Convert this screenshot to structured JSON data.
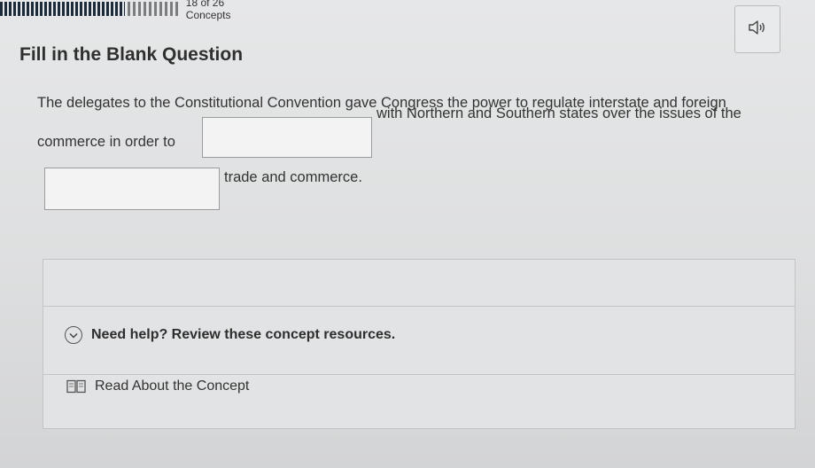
{
  "progress": {
    "text": "18 of 26 Concepts",
    "fraction": 0.69
  },
  "question": {
    "title": "Fill in the Blank Question",
    "line1": "The delegates to the Constitutional Convention gave Congress the power to regulate interstate and foreign",
    "line2_before": "commerce in order to",
    "line2_after": "with Northern and Southern states over the issues of the",
    "line3_after": "trade and commerce.",
    "blank1_value": "",
    "blank2_value": ""
  },
  "help": {
    "toggle_label": "Need help? Review these concept resources.",
    "resource_label": "Read About the Concept"
  },
  "icons": {
    "audio": "speaker-icon",
    "toggle": "chevron-down-circle-icon",
    "resource": "book-icon"
  }
}
